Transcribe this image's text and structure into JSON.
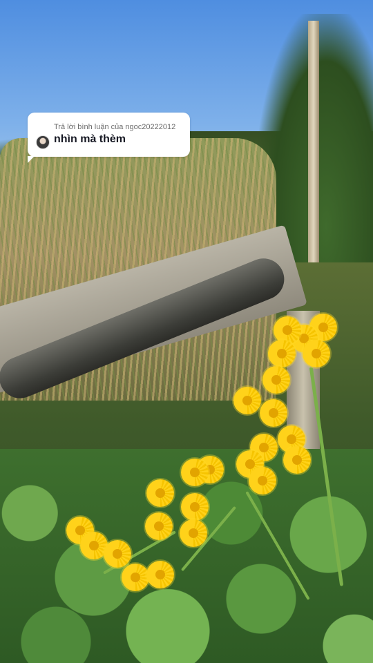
{
  "reply": {
    "caption": "Trả lời bình luận của ngoc20222012",
    "comment": "nhìn mà thèm",
    "icon": "user-avatar"
  },
  "scene": {
    "description_colors": {
      "sky": "#6fa3e0",
      "flower": "#ffd21a",
      "leaf": "#5e9b44"
    }
  }
}
